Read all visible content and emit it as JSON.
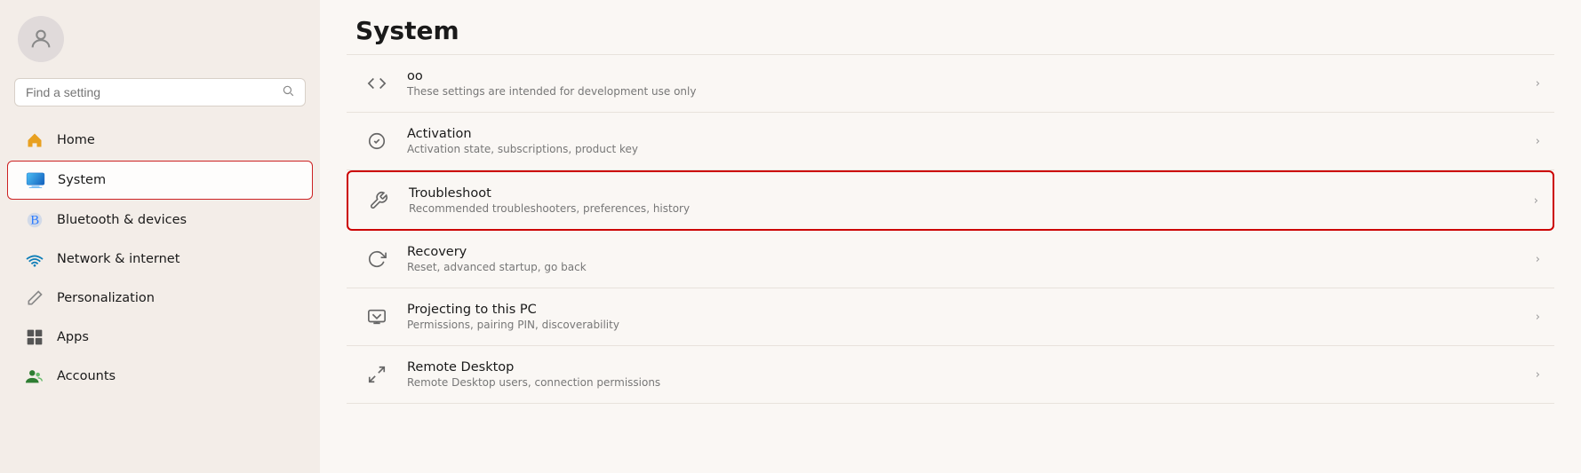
{
  "page": {
    "title": "System"
  },
  "sidebar": {
    "search_placeholder": "Find a setting",
    "nav_items": [
      {
        "id": "home",
        "label": "Home",
        "icon": "home"
      },
      {
        "id": "system",
        "label": "System",
        "icon": "system",
        "active": true
      },
      {
        "id": "bluetooth",
        "label": "Bluetooth & devices",
        "icon": "bluetooth"
      },
      {
        "id": "network",
        "label": "Network & internet",
        "icon": "network"
      },
      {
        "id": "personalization",
        "label": "Personalization",
        "icon": "pencil"
      },
      {
        "id": "apps",
        "label": "Apps",
        "icon": "apps"
      },
      {
        "id": "accounts",
        "label": "Accounts",
        "icon": "accounts"
      }
    ]
  },
  "main": {
    "title": "System",
    "settings_items": [
      {
        "id": "developer",
        "title": "oo",
        "subtitle": "These settings are intended for development use only",
        "icon": "dev",
        "highlighted": false
      },
      {
        "id": "activation",
        "title": "Activation",
        "subtitle": "Activation state, subscriptions, product key",
        "icon": "check-circle",
        "highlighted": false
      },
      {
        "id": "troubleshoot",
        "title": "Troubleshoot",
        "subtitle": "Recommended troubleshooters, preferences, history",
        "icon": "wrench",
        "highlighted": true
      },
      {
        "id": "recovery",
        "title": "Recovery",
        "subtitle": "Reset, advanced startup, go back",
        "icon": "recovery",
        "highlighted": false
      },
      {
        "id": "projecting",
        "title": "Projecting to this PC",
        "subtitle": "Permissions, pairing PIN, discoverability",
        "icon": "projecting",
        "highlighted": false
      },
      {
        "id": "remote-desktop",
        "title": "Remote Desktop",
        "subtitle": "Remote Desktop users, connection permissions",
        "icon": "remote",
        "highlighted": false
      }
    ]
  }
}
